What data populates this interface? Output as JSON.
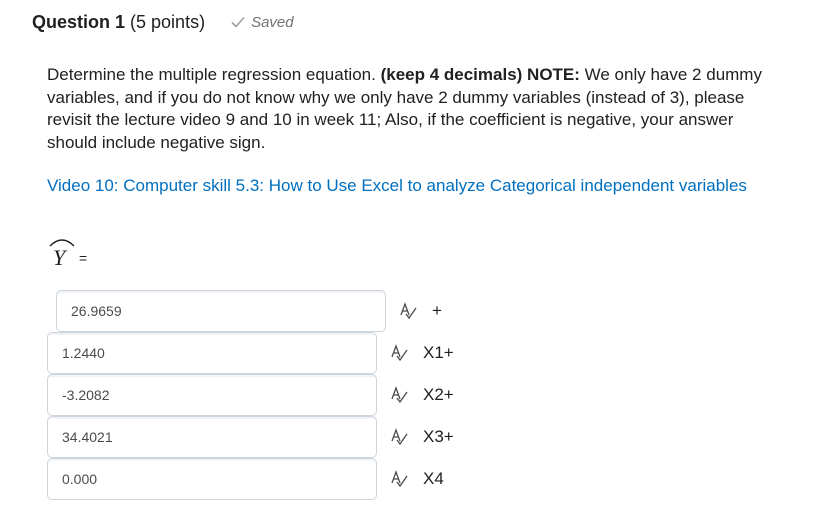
{
  "question": {
    "number": "Question 1",
    "points": "(5 points)",
    "status": "Saved"
  },
  "prompt": {
    "part1": "Determine the multiple regression equation. ",
    "bold1": "(keep 4 decimals) NOTE:",
    "part2": " We only have 2 dummy variables, and if you do not know why we only have 2 dummy variables (instead of 3), please revisit the lecture video 9 and 10 in week 11; Also, if the coefficient is negative, your answer should include negative sign."
  },
  "link_text": "Video 10: Computer skill 5.3: How to Use Excel to analyze Categorical independent variables",
  "equation": {
    "symbol": "Y",
    "equals": "="
  },
  "answers": [
    {
      "value": "26.9659",
      "term": "+"
    },
    {
      "value": "1.2440",
      "term": "X1+"
    },
    {
      "value": "-3.2082",
      "term": "X2+"
    },
    {
      "value": "34.4021",
      "term": "X3+"
    },
    {
      "value": "0.000",
      "term": "X4"
    }
  ],
  "icons": {
    "saved": "checkmark-icon",
    "spellcheck": "spellcheck-icon"
  },
  "colors": {
    "link": "#006fbf",
    "text": "#202122",
    "border": "#cdd5dc"
  }
}
